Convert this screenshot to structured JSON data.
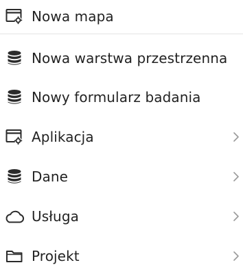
{
  "colors": {
    "text": "#222222",
    "icon": "#2b2b2b",
    "chevron": "#9a9a9a",
    "divider": "#e4e4e4"
  },
  "menu": {
    "items": [
      {
        "label": "Nowa mapa",
        "icon": "map-window-icon",
        "has_submenu": false
      },
      {
        "label": "Nowa warstwa przestrzenna",
        "icon": "database-icon",
        "has_submenu": false
      },
      {
        "label": "Nowy formularz badania",
        "icon": "database-icon",
        "has_submenu": false
      },
      {
        "label": "Aplikacja",
        "icon": "app-window-icon",
        "has_submenu": true
      },
      {
        "label": "Dane",
        "icon": "database-icon",
        "has_submenu": true
      },
      {
        "label": "Usługa",
        "icon": "cloud-icon",
        "has_submenu": true
      },
      {
        "label": "Projekt",
        "icon": "folder-icon",
        "has_submenu": true
      }
    ]
  }
}
